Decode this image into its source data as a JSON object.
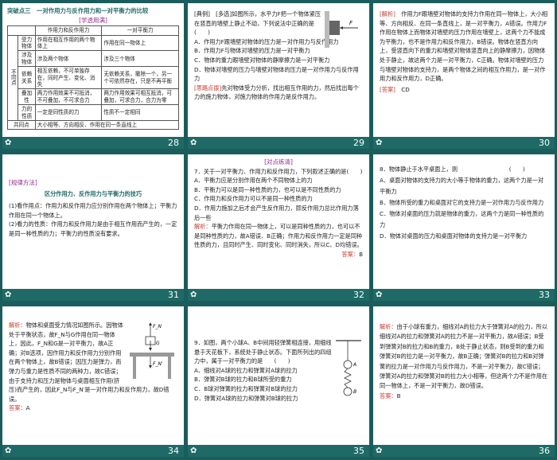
{
  "slides": [
    {
      "num": "28",
      "title": "突破点三　一对作用力与反作用力和一对平衡力的比较",
      "subtitle": "[学透用满]",
      "table": {
        "headers": [
          "",
          "",
          "作用力和反作用力",
          "一对平衡力"
        ],
        "group_label": "不同点",
        "rows": [
          [
            "受力物体",
            "作用在相互作用的两个物体上",
            "作用在同一物体上"
          ],
          [
            "涉及物体",
            "涉及两个物体",
            "涉及三个物体"
          ],
          [
            "依赖关系",
            "相互依赖，不可单独存在，同时产生、变化、消失",
            "无依赖关系，撤除一个，另一个可依然存在，只是不再平衡"
          ],
          [
            "叠加性",
            "两力作用效果不可抵消，不可叠加，不可求合力",
            "两力作用效果可相互抵消，可叠加，可求合力，合力为零"
          ],
          [
            "力的性质",
            "一定是同性质的力",
            "性质不一定相同"
          ]
        ],
        "common_label": "共同点",
        "common_text": "大小相等、方向相反、作用在同一条直线上"
      }
    },
    {
      "num": "29",
      "lines": [
        "[典例]　[多选]如图所示，水平力F把一个物体紧压在竖直的墙壁上静止不动，下列说法中正确的是　　(　　)",
        "A．作用力F跟墙壁对物体的压力是一对作用力与反作用力",
        "B．作用力F与物体对墙壁的压力是一对平衡力",
        "C．物体的重力跟墙壁对物体的静摩擦力是一对平衡力",
        "D．物体对墙壁的压力与墙壁对物体的压力是一对作用力与反作用力"
      ],
      "hint_label": "[思路点拨]",
      "hint_text": "先对物体受力分析，找出相互作用的力，然后找出每个力的施力物体，对施力物体的作用力是反作用力。",
      "force_label": "F"
    },
    {
      "num": "30",
      "analysis_label": "[解析]",
      "analysis_text": "作用力F跟墙壁对物体的支持力作用在同一物体上，大小相等、方向相反、在同一条直线上，是一对平衡力，A错误。作用力F作用在物体上而物体对墙壁的压力作用在墙壁上，这两个力不能成为平衡力，也不是作用力和反作用力，B错误。物体在竖直方向上，受竖直向下的重力和墙壁对物体竖直向上的静摩擦力，因物体处于静止，故这两个力是一对平衡力，C正确。物体对墙壁的压力与墙壁对物体的支持力，是两个物体之间的相互作用力，是一对作用力和反作用力，D正确。",
      "answer_label": "[答案]",
      "answer_text": "CD"
    },
    {
      "num": "31",
      "method_label": "[规律方法]",
      "heading": "区分作用力、反作用力与平衡力的技巧",
      "items": [
        "(1)看作用点：作用力和反作用力应分别作用在两个物体上；平衡力作用在同一个物体上。",
        "(2)看力的性质：作用力和反作用力是由于相互作用而产生的，一定是同一种性质的力；平衡力的性质没有要求。"
      ]
    },
    {
      "num": "32",
      "practice_label": "[对点练清]",
      "question": "7．关于一对平衡力、作用力和反作用力，下列叙述正确的是(　　)",
      "options": [
        "A．平衡力应是分别作用在两个不同物体上的力",
        "B．平衡力可以是同一种性质的力，也可以是不同性质的力",
        "C．作用力和反作用力可以不是同一种性质的力",
        "D．作用力施加之后才会产生反作用力，即反作用力总比作用力落后一些"
      ],
      "analysis_label": "解析：",
      "analysis_text": "平衡力作用在同一物体上，可以是同种性质的力，也可以不是同种性质的力，故A错误、B正确；作用力和反作用力一定是同种性质的力，且同时产生、同时变化、同时消失，所以C、D均错误。",
      "answer_label": "答案：",
      "answer_text": "B"
    },
    {
      "num": "33",
      "question": "8．物体静止于水平桌面上，则　　　　　　　　　(　　)",
      "options": [
        "A．桌面对物体的支持力的大小等于物体的重力，这两个力是一对平衡力",
        "B．物体所受的重力和桌面对它的支持力是一对作用力与反作用力",
        "C．物体对桌面的压力就是物体的重力，这两个力是同一种性质的力",
        "D．物体对桌面的压力和桌面对物体的支持力是一对平衡力"
      ]
    },
    {
      "num": "34",
      "analysis_label": "解析：",
      "analysis_text": "物体和桌面受力情况如图所示。因物体处于平衡状态，故F_N与G作用在同一物体上，因此，F_N和G是一对平衡力，故A正确；对B选项，因作用力和反作用力分别作用在两个物体上，故B错误；因压力是弹力，而弹力与重力是性质不同的两种力，故C错误；由于支持力和压力是物体与桌面相互作用(挤压)而产生的，因此F_N与F_N′是一对作用力和反作用力，故D错误。",
      "answer_label": "答案：",
      "answer_text": "A",
      "fig_fn": "F_N",
      "fig_g": "G",
      "fig_fn2": "F_N′"
    },
    {
      "num": "35",
      "question": "9．如图，两个小球A、B中间用轻弹簧相连接，用细线悬于天花板下，系统处于静止状态。下面所列出的四组力中，属于一对平衡力的是　　(　　)",
      "options": [
        "A．细线对A球的拉力和弹簧对A球的拉力",
        "B．弹簧对B球的拉力和B球所受的重力",
        "C．B球对弹簧的拉力和弹簧对B球的拉力",
        "D．弹簧对A球的拉力和弹簧对B球的拉力"
      ],
      "fig_a": "A",
      "fig_b": "B"
    },
    {
      "num": "36",
      "analysis_label": "解析：",
      "analysis_text": "由于小球有重力，细线对A的拉力大于弹簧对A的拉力，所以细线对A的拉力和弹簧对A的拉力不是一对平衡力，故A错误；B受到弹簧对B的拉力和B的重力，B处于静止状态，则B受到的重力和弹簧对B的拉力是一对平衡力，故B正确；弹簧对B的拉力和B对弹簧的拉力是一对作用力与反作用力，不是一对平衡力，故C错误；弹簧对A的拉力和弹簧对B的拉力大小相等，但这两个力不是作用在同一物体上，不是一对平衡力，故D错误。",
      "answer_label": "答案：",
      "answer_text": "B"
    }
  ]
}
